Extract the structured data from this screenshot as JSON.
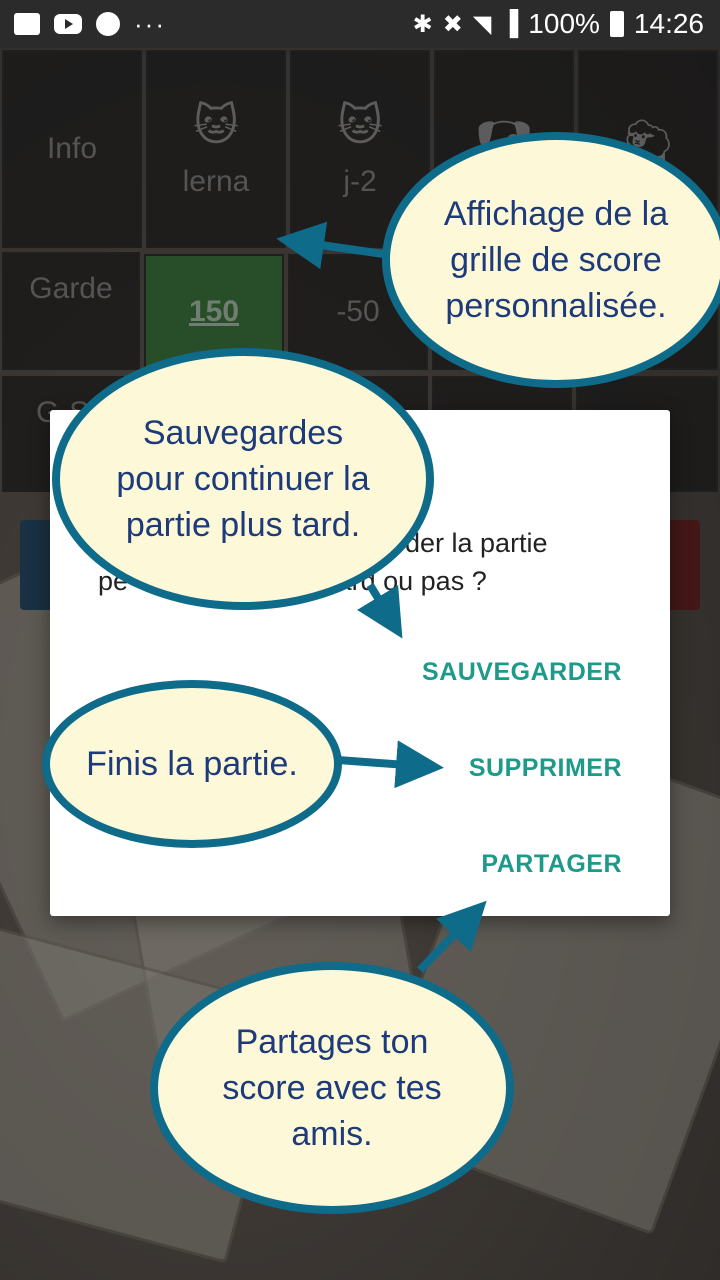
{
  "status_bar": {
    "more": "···",
    "bluetooth": "✱",
    "mute": "✖",
    "wifi": "◥",
    "signal": "▐",
    "battery_pct": "100%",
    "time": "14:26"
  },
  "grid": {
    "info_label": "Info",
    "players": [
      {
        "name": "lerna",
        "icon": "cat-icon"
      },
      {
        "name": "j-2",
        "icon": "cat-icon"
      },
      {
        "name": "",
        "icon": "dog-icon"
      },
      {
        "name": "",
        "icon": "sheep-icon"
      }
    ],
    "rows": [
      {
        "label": "Garde",
        "values": [
          "150",
          "-50"
        ]
      },
      {
        "label": "G-Sa",
        "values": []
      }
    ]
  },
  "dialog": {
    "message": "Voulez-vous sauvegarder la partie pour la reprendre plutard ou pas ?",
    "message_visible_line1": "rder la partie",
    "message_visible_line2": "pe                      plutard ou pas ?",
    "actions": {
      "save": "SAUVEGARDER",
      "delete": "SUPPRIMER",
      "share": "PARTAGER"
    }
  },
  "callouts": {
    "grid": "Affichage de la\ngrille de score\npersonnalisée.",
    "save": "Sauvegardes\npour continuer la\npartie plus tard.",
    "delete": "Finis la partie.",
    "share": "Partages ton\nscore avec tes\namis."
  },
  "colors": {
    "accent": "#1d9a8a",
    "callout_border": "#0e6b8a",
    "callout_fill": "#fdf9d8",
    "callout_text": "#1d3a7a",
    "score_green": "#4a8f4c"
  }
}
